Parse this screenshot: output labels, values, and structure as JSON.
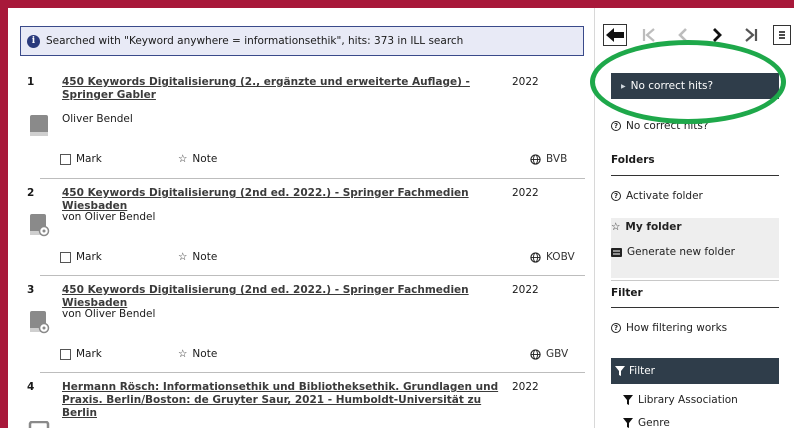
{
  "info": {
    "text": "Searched with \"Keyword anywhere = informationsethik\", hits: 373 in ILL search"
  },
  "results": [
    {
      "num": "1",
      "title": "450 Keywords Digitalisierung (2., ergänzte und erweiterte Auflage) - Springer Gabler",
      "year": "2022",
      "author": "Oliver Bendel",
      "mark": "Mark",
      "note": "Note",
      "source": "BVB"
    },
    {
      "num": "2",
      "title": "450 Keywords Digitalisierung (2nd ed. 2022.) - Springer Fachmedien Wiesbaden",
      "year": "2022",
      "author": "von Oliver Bendel",
      "mark": "Mark",
      "note": "Note",
      "source": "KOBV"
    },
    {
      "num": "3",
      "title": "450 Keywords Digitalisierung (2nd ed. 2022.) - Springer Fachmedien Wiesbaden",
      "year": "2022",
      "author": "von Oliver Bendel",
      "mark": "Mark",
      "note": "Note",
      "source": "GBV"
    },
    {
      "num": "4",
      "title": "Hermann Rösch: Informationsethik und Bibliotheksethik. Grundlagen und Praxis. Berlin/Boston: de Gruyter Saur, 2021 - Humboldt-Universität zu Berlin",
      "year": "2022"
    }
  ],
  "sidebar": {
    "no_hits_button": "No correct hits?",
    "no_hits_link": "No correct hits?",
    "folders_heading": "Folders",
    "activate_folder": "Activate folder",
    "my_folder": "My folder",
    "generate_folder": "Generate new folder",
    "filter_heading": "Filter",
    "how_filtering": "How filtering works",
    "filter_bar": "Filter",
    "filter_items": [
      "Library Association",
      "Genre"
    ]
  },
  "colors": {
    "frame": "#a8183a",
    "highlight": "#1ea84a",
    "dark_bar": "#2f3d4a",
    "info_bg": "#e8eaf6"
  }
}
